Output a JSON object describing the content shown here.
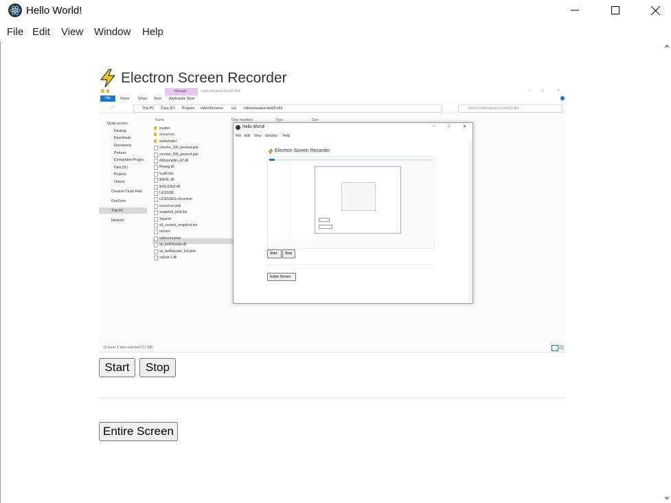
{
  "window": {
    "title": "Hello World!",
    "controls": {
      "minimize": "minimize-icon",
      "maximize": "maximize-icon",
      "close": "close-icon"
    }
  },
  "menu": [
    "File",
    "Edit",
    "View",
    "Window",
    "Help"
  ],
  "page": {
    "heading": "Electron Screen Recorder",
    "buttons": {
      "start": "Start",
      "stop": "Stop",
      "entire_screen": "Entire Screen"
    }
  },
  "preview": {
    "ribbon_context": "Manage",
    "ribbon_path_title": "videostreamer-win32-x64",
    "ribbon_tabs": [
      "File",
      "Home",
      "Share",
      "View",
      "Application Tools"
    ],
    "address": [
      "This PC",
      "Data (D:)",
      "Projects",
      "videoStreamer",
      "out",
      "videostreamer-win32-x64"
    ],
    "search_placeholder": "Search videostreamer-win32-x64",
    "nav_items": [
      "Quick access",
      "Desktop",
      "Downloads",
      "Documents",
      "Pictures",
      "Competitive Progra",
      "Data (D:)",
      "Projects",
      "Videos",
      "Creative Cloud Files",
      "OneDrive",
      "This PC",
      "Network"
    ],
    "columns": [
      "Name",
      "Date modified",
      "Type",
      "Size"
    ],
    "files": [
      "locales",
      "resources",
      "swiftshader",
      "chrome_100_percent.pak",
      "chrome_200_percent.pak",
      "d3dcompiler_47.dll",
      "ffmpeg.dll",
      "icudtl.dat",
      "libEGL.dll",
      "libGLESv2.dll",
      "LICENSE",
      "LICENSES.chromium",
      "resources.pak",
      "snapshot_blob.bin",
      "Squirrel",
      "v8_context_snapshot.bin",
      "version",
      "videostreamer",
      "vk_swiftshader.dll",
      "vk_swiftshader_icd.json",
      "vulkan-1.dll"
    ],
    "status": "21 items    1 item selected  117 MB",
    "inner_window_title": "Hello World!",
    "inner_menu": [
      "File",
      "Edit",
      "View",
      "Window",
      "Help"
    ],
    "inner_heading": "Electron Screen Recorder",
    "inner_buttons": [
      "Start",
      "Stop",
      "Entire Screen"
    ]
  },
  "colors": {
    "ribbon_blue": "#1979ca",
    "manage_tab": "#e9c7f2",
    "selected_row": "#d9d9d9",
    "bolt": "#f5c518"
  }
}
